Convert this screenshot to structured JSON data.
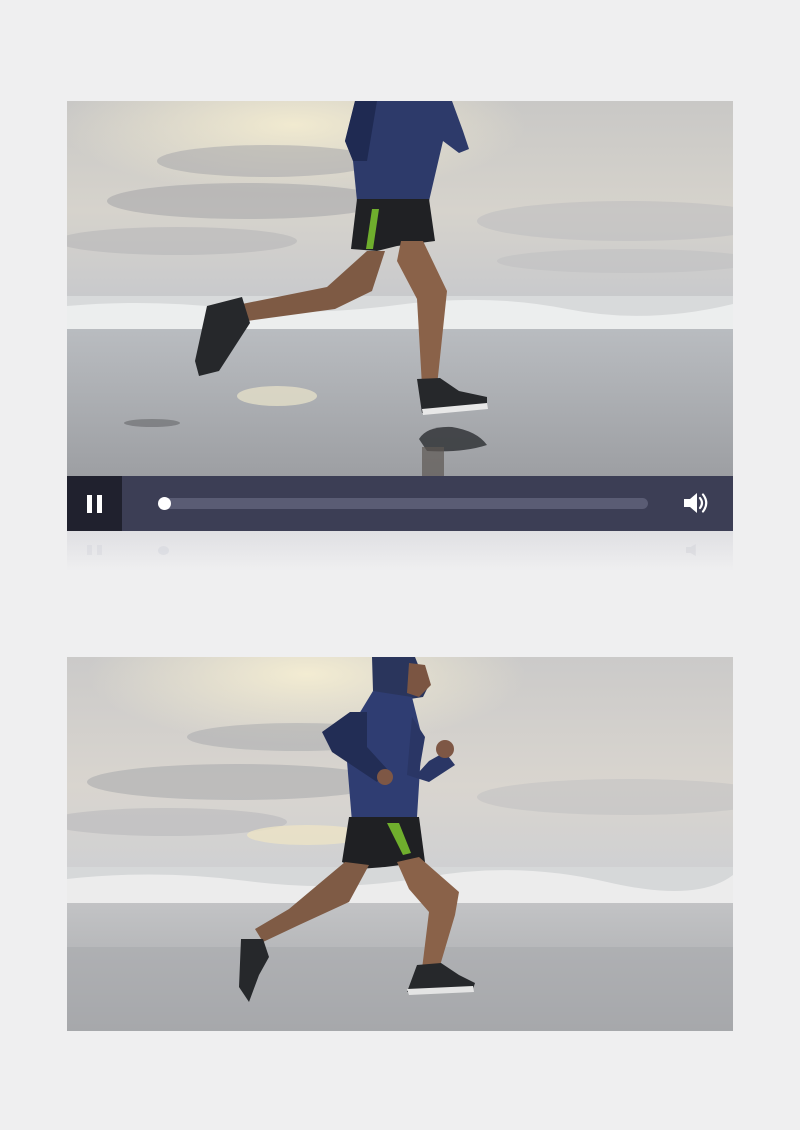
{
  "player": {
    "state": "paused-display",
    "progress": 0.0,
    "pause_icon": "pause-icon",
    "volume_icon": "speaker-icon"
  },
  "colors": {
    "page_bg": "#efeff0",
    "control_bar": "#3c3e55",
    "pause_button_bg": "#20212e",
    "track": "#5a5c74",
    "knob": "#ffffff"
  },
  "frames": [
    {
      "subject": "runner-legs-on-beach"
    },
    {
      "subject": "runner-full-body-on-beach"
    }
  ]
}
